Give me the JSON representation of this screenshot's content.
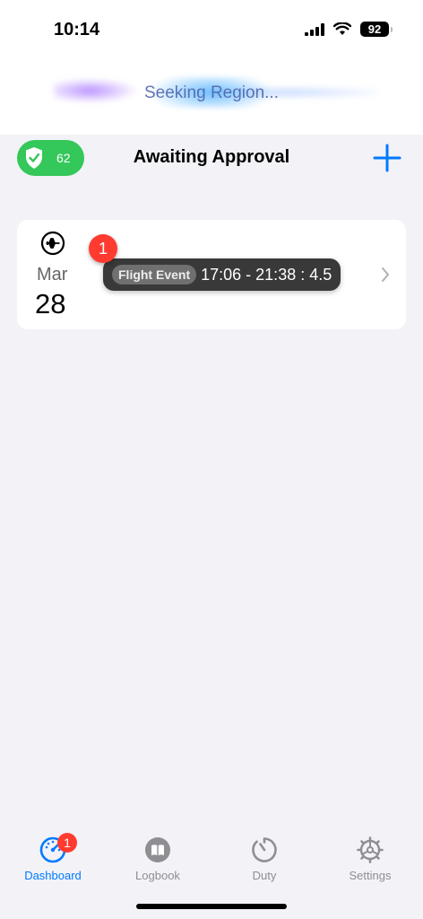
{
  "status_bar": {
    "time": "10:14",
    "battery": "92"
  },
  "banner": {
    "text": "Seeking Region..."
  },
  "header": {
    "shield_count": "62",
    "title": "Awaiting Approval"
  },
  "card": {
    "month": "Mar",
    "day": "28",
    "notification_count": "1",
    "event_tag": "Flight Event",
    "event_times": "17:06 - 21:38 : 4.5"
  },
  "tabbar": {
    "tabs": [
      {
        "label": "Dashboard",
        "badge": "1",
        "icon": "dashboard-gauge-icon"
      },
      {
        "label": "Logbook",
        "icon": "book-icon"
      },
      {
        "label": "Duty",
        "icon": "timer-icon"
      },
      {
        "label": "Settings",
        "icon": "gear-icon"
      }
    ]
  },
  "colors": {
    "accent": "#007aff",
    "shield_green": "#34c759",
    "badge_red": "#ff3b30"
  }
}
